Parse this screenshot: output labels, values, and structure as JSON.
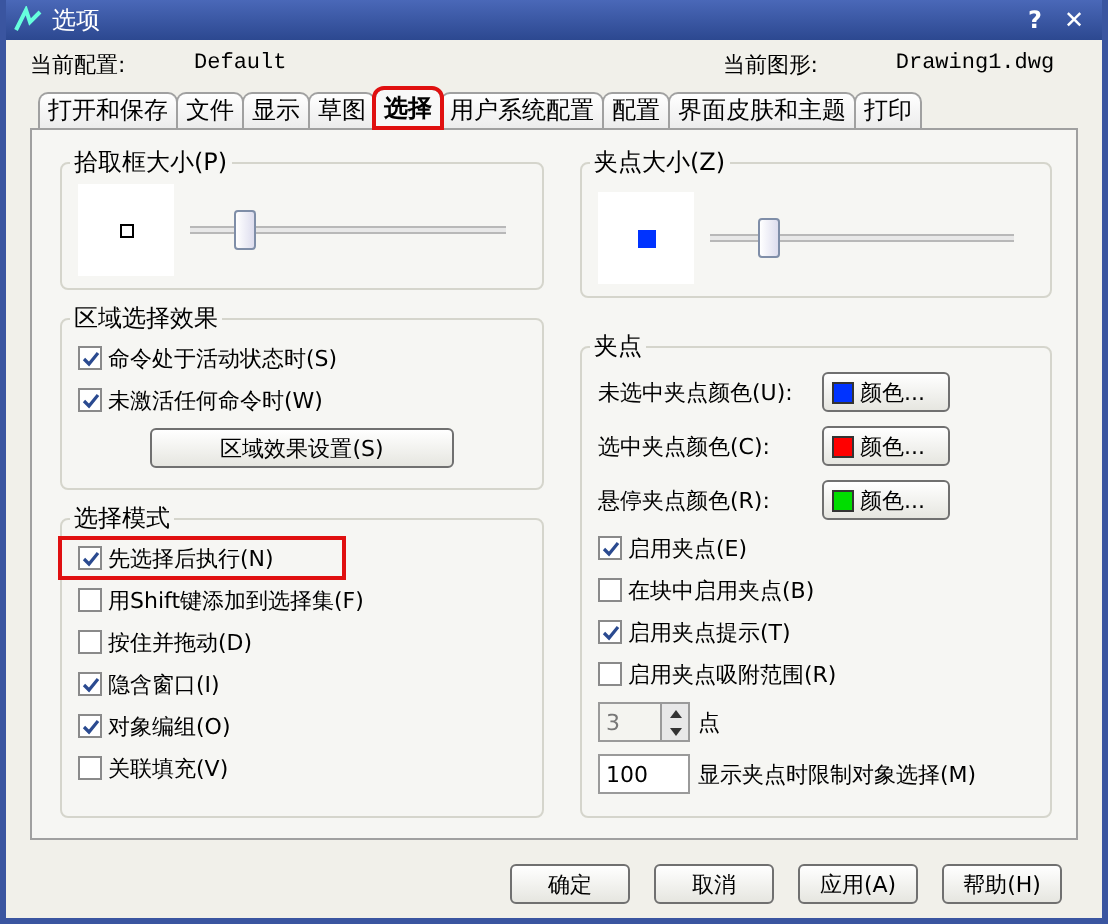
{
  "window": {
    "title": "选项",
    "help": "?",
    "close": "✕"
  },
  "profile": {
    "label": "当前配置:",
    "value": "Default"
  },
  "drawing": {
    "label": "当前图形:",
    "value": "Drawing1.dwg"
  },
  "tabs": [
    {
      "label": "打开和保存",
      "selected": false,
      "highlighted": false
    },
    {
      "label": "文件",
      "selected": false,
      "highlighted": false
    },
    {
      "label": "显示",
      "selected": false,
      "highlighted": false
    },
    {
      "label": "草图",
      "selected": false,
      "highlighted": false
    },
    {
      "label": "选择",
      "selected": true,
      "highlighted": true
    },
    {
      "label": "用户系统配置",
      "selected": false,
      "highlighted": false
    },
    {
      "label": "配置",
      "selected": false,
      "highlighted": false
    },
    {
      "label": "界面皮肤和主题",
      "selected": false,
      "highlighted": false
    },
    {
      "label": "打印",
      "selected": false,
      "highlighted": false
    }
  ],
  "pickbox": {
    "title": "拾取框大小(P)",
    "level": 0.17
  },
  "area_effect": {
    "title": "区域选择效果",
    "options": [
      {
        "label": "命令处于活动状态时(S)",
        "checked": true
      },
      {
        "label": "未激活任何命令时(W)",
        "checked": true
      }
    ],
    "button": "区域效果设置(S)"
  },
  "selection_modes": {
    "title": "选择模式",
    "options": [
      {
        "label": "先选择后执行(N)",
        "checked": true,
        "highlighted": true
      },
      {
        "label": "用Shift键添加到选择集(F)",
        "checked": false,
        "highlighted": false
      },
      {
        "label": "按住并拖动(D)",
        "checked": false,
        "highlighted": false
      },
      {
        "label": "隐含窗口(I)",
        "checked": true,
        "highlighted": false
      },
      {
        "label": "对象编组(O)",
        "checked": true,
        "highlighted": false
      },
      {
        "label": "关联填充(V)",
        "checked": false,
        "highlighted": false
      }
    ]
  },
  "grip_size": {
    "title": "夹点大小(Z)",
    "level": 0.19
  },
  "grips": {
    "title": "夹点",
    "colors": [
      {
        "label": "未选中夹点颜色(U):",
        "button": "颜色...",
        "color": "#0033ff"
      },
      {
        "label": "选中夹点颜色(C):",
        "button": "颜色...",
        "color": "#ff0000"
      },
      {
        "label": "悬停夹点颜色(R):",
        "button": "颜色...",
        "color": "#00dd00"
      }
    ],
    "options": [
      {
        "label": "启用夹点(E)",
        "checked": true
      },
      {
        "label": "在块中启用夹点(B)",
        "checked": false
      },
      {
        "label": "启用夹点提示(T)",
        "checked": true
      },
      {
        "label": "启用夹点吸附范围(R)",
        "checked": false
      }
    ],
    "spinner": {
      "value": "3",
      "unit": "点",
      "disabled": true
    },
    "limit": {
      "value": "100",
      "label": "显示夹点时限制对象选择(M)"
    }
  },
  "buttons": [
    "确定",
    "取消",
    "应用(A)",
    "帮助(H)"
  ]
}
